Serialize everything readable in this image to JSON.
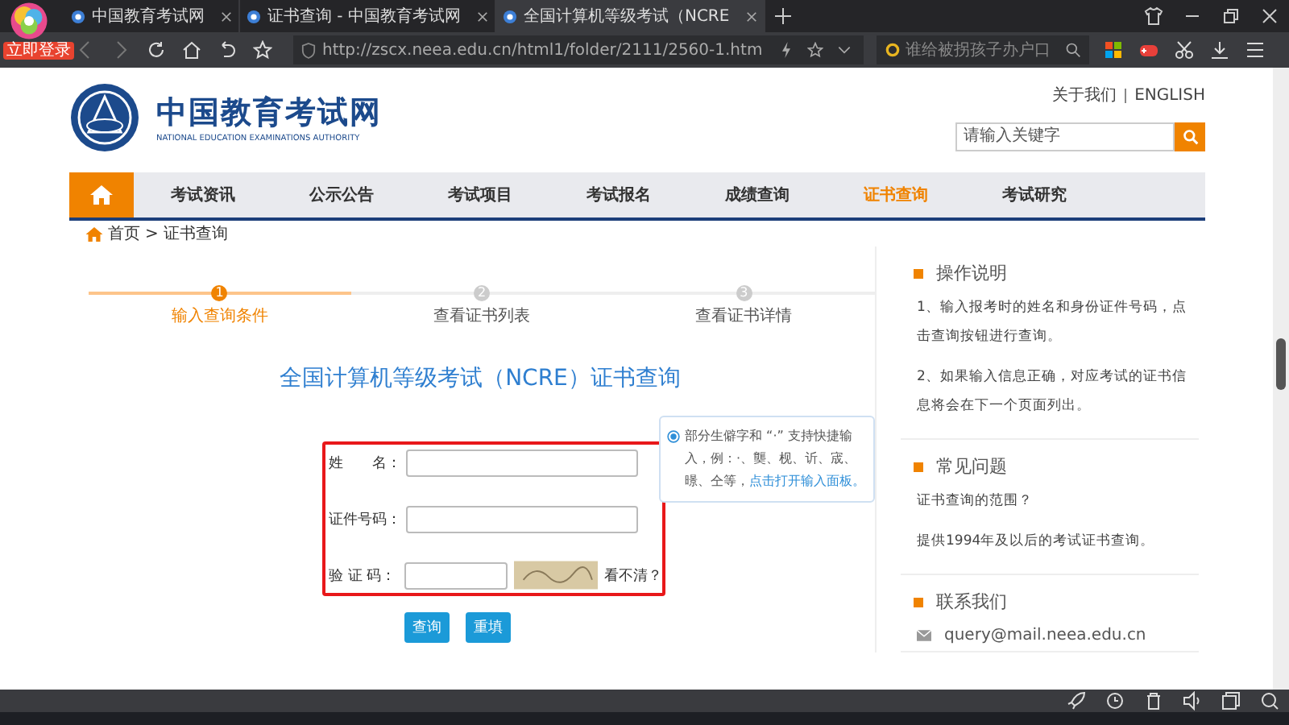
{
  "browser": {
    "login_badge": "立即登录",
    "tabs": [
      {
        "title": "中国教育考试网",
        "selected": false
      },
      {
        "title": "证书查询 - 中国教育考试网",
        "selected": false
      },
      {
        "title": "全国计算机等级考试（NCRE",
        "selected": true
      }
    ],
    "address": "http://zscx.neea.edu.cn/html1/folder/2111/2560-1.htm",
    "search_placeholder": "谁给被拐孩子办户口"
  },
  "header": {
    "logo_title": "中国教育考试网",
    "logo_subtitle": "NATIONAL EDUCATION EXAMINATIONS AUTHORITY",
    "top_links": [
      "关于我们",
      "ENGLISH"
    ],
    "search_placeholder": "请输入关键字"
  },
  "nav": [
    {
      "label": "考试资讯",
      "selected": false
    },
    {
      "label": "公示公告",
      "selected": false
    },
    {
      "label": "考试项目",
      "selected": false
    },
    {
      "label": "考试报名",
      "selected": false
    },
    {
      "label": "成绩查询",
      "selected": false
    },
    {
      "label": "证书查询",
      "selected": true
    },
    {
      "label": "考试研究",
      "selected": false
    }
  ],
  "breadcrumb": {
    "items": [
      "首页",
      "证书查询"
    ],
    "separator": ">"
  },
  "steps": [
    {
      "number": "1",
      "label": "输入查询条件",
      "selected": true
    },
    {
      "number": "2",
      "label": "查看证书列表",
      "selected": false
    },
    {
      "number": "3",
      "label": "查看证书详情",
      "selected": false
    }
  ],
  "form": {
    "title": "全国计算机等级考试（NCRE）证书查询",
    "fields": [
      {
        "label": "姓　　名：",
        "kind": "text"
      },
      {
        "label": "证件号码：",
        "kind": "text"
      },
      {
        "label": "验 证 码：",
        "kind": "captcha",
        "refresh_link": "看不清？"
      }
    ],
    "buttons": [
      "查询",
      "重填"
    ],
    "tip": {
      "text": "部分生僻字和 “·” 支持快捷输入，例：·、龑、枧、䜣、宬、暻、仝等，",
      "link": "点击打开输入面板。"
    }
  },
  "sidebar": [
    {
      "title": "操作说明",
      "paragraphs": [
        "1、输入报考时的姓名和身份证件号码，点击查询按钮进行查询。",
        "2、如果输入信息正确，对应考试的证书信息将会在下一个页面列出。"
      ]
    },
    {
      "title": "常见问题",
      "paragraphs": [
        "证书查询的范围？",
        "提供1994年及以后的考试证书查询。"
      ]
    },
    {
      "title": "联系我们",
      "email": "query@mail.neea.edu.cn"
    }
  ]
}
